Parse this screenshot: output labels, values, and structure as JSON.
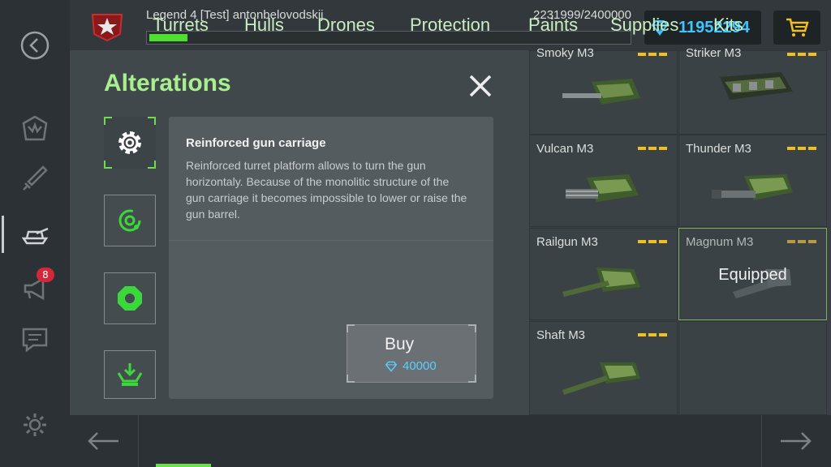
{
  "header": {
    "player": "Legend 4 [Test] antonbelovodskij",
    "xp_text": "2231999/2400000",
    "xp_progress": 0.079,
    "crystals": "11952294"
  },
  "sidebar": {
    "items": [
      {
        "name": "back-icon"
      },
      {
        "name": "garage-icon"
      },
      {
        "name": "battle-sword-icon"
      },
      {
        "name": "tank-icon",
        "active": true
      },
      {
        "name": "megaphone-icon",
        "badge": "8"
      },
      {
        "name": "chat-icon"
      },
      {
        "name": "settings-icon"
      }
    ]
  },
  "grid": {
    "items": [
      {
        "name": "Smoky M3"
      },
      {
        "name": "Striker M3"
      },
      {
        "name": "Vulcan M3"
      },
      {
        "name": "Thunder M3"
      },
      {
        "name": "Railgun M3"
      },
      {
        "name": "Magnum M3",
        "status": "Equipped"
      },
      {
        "name": "Shaft M3"
      }
    ]
  },
  "tabs": {
    "items": [
      "Turrets",
      "Hulls",
      "Drones",
      "Protection",
      "Paints",
      "Supplies",
      "Kits"
    ],
    "active": "Turrets"
  },
  "modal": {
    "title": "Alterations",
    "alteration_title": "Reinforced gun carriage",
    "alteration_desc": "Reinforced turret platform allows to turn the gun horizontaly. Because of the monolitic structure of the gun carriage it becomes impossible to lower or raise the gun barrel.",
    "buy_label": "Buy",
    "buy_price": "40000"
  },
  "colors": {
    "accent_green": "#6be04c",
    "crystal_blue": "#3fc5ff",
    "upgrade_dots": "#f0c020",
    "badge_red": "#d4283a"
  }
}
